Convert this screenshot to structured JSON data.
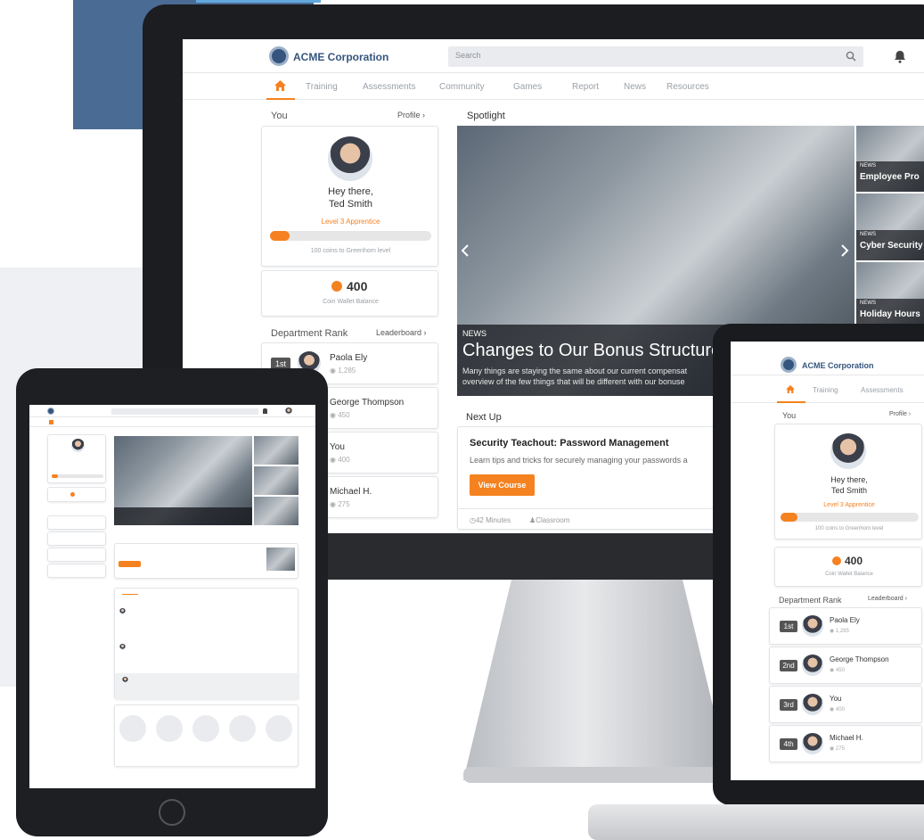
{
  "brand": {
    "name": "ACME Corporation",
    "orange": "#f58220",
    "navy": "#35557e"
  },
  "search": {
    "placeholder": "Search"
  },
  "nav": {
    "items": [
      "Training",
      "Assessments",
      "Community",
      "Games",
      "Report",
      "News",
      "Resources"
    ]
  },
  "you": {
    "title": "You",
    "profile_link": "Profile",
    "greeting_line1": "Hey there,",
    "greeting_line2": "Ted Smith",
    "level": "Level 3 Apprentice",
    "level_progress": 0.12,
    "coins_to_next": "100 coins to Greenhorn level",
    "wallet_value": "400",
    "wallet_label": "Coin Wallet Balance"
  },
  "department": {
    "title": "Department Rank",
    "leaderboard_link": "Leaderboard",
    "entries": [
      {
        "rank": "1st",
        "name": "Paola Ely",
        "points": "1,285"
      },
      {
        "rank": "2nd",
        "name": "George Thompson",
        "points": "450"
      },
      {
        "rank": "3rd",
        "name": "You",
        "points": "400"
      },
      {
        "rank": "4th",
        "name": "Michael H.",
        "points": "275"
      }
    ]
  },
  "spotlight": {
    "title": "Spotlight",
    "tag": "NEWS",
    "headline": "Changes to Our Bonus Structure",
    "body_line1": "Many things are staying the same about our current compensat",
    "body_line2": "overview of the few things that will be different with our bonuse",
    "side_items": [
      {
        "tag": "NEWS",
        "title": "Employee Pro"
      },
      {
        "tag": "NEWS",
        "title": "Cyber Security"
      },
      {
        "tag": "NEWS",
        "title": "Holiday Hours"
      }
    ]
  },
  "next_up": {
    "title": "Next Up",
    "course_title": "Security Teachout: Password Management",
    "course_desc": "Learn tips and tricks for securely managing your passwords a",
    "button": "View Course",
    "duration": "42 Minutes",
    "format": "Classroom"
  }
}
